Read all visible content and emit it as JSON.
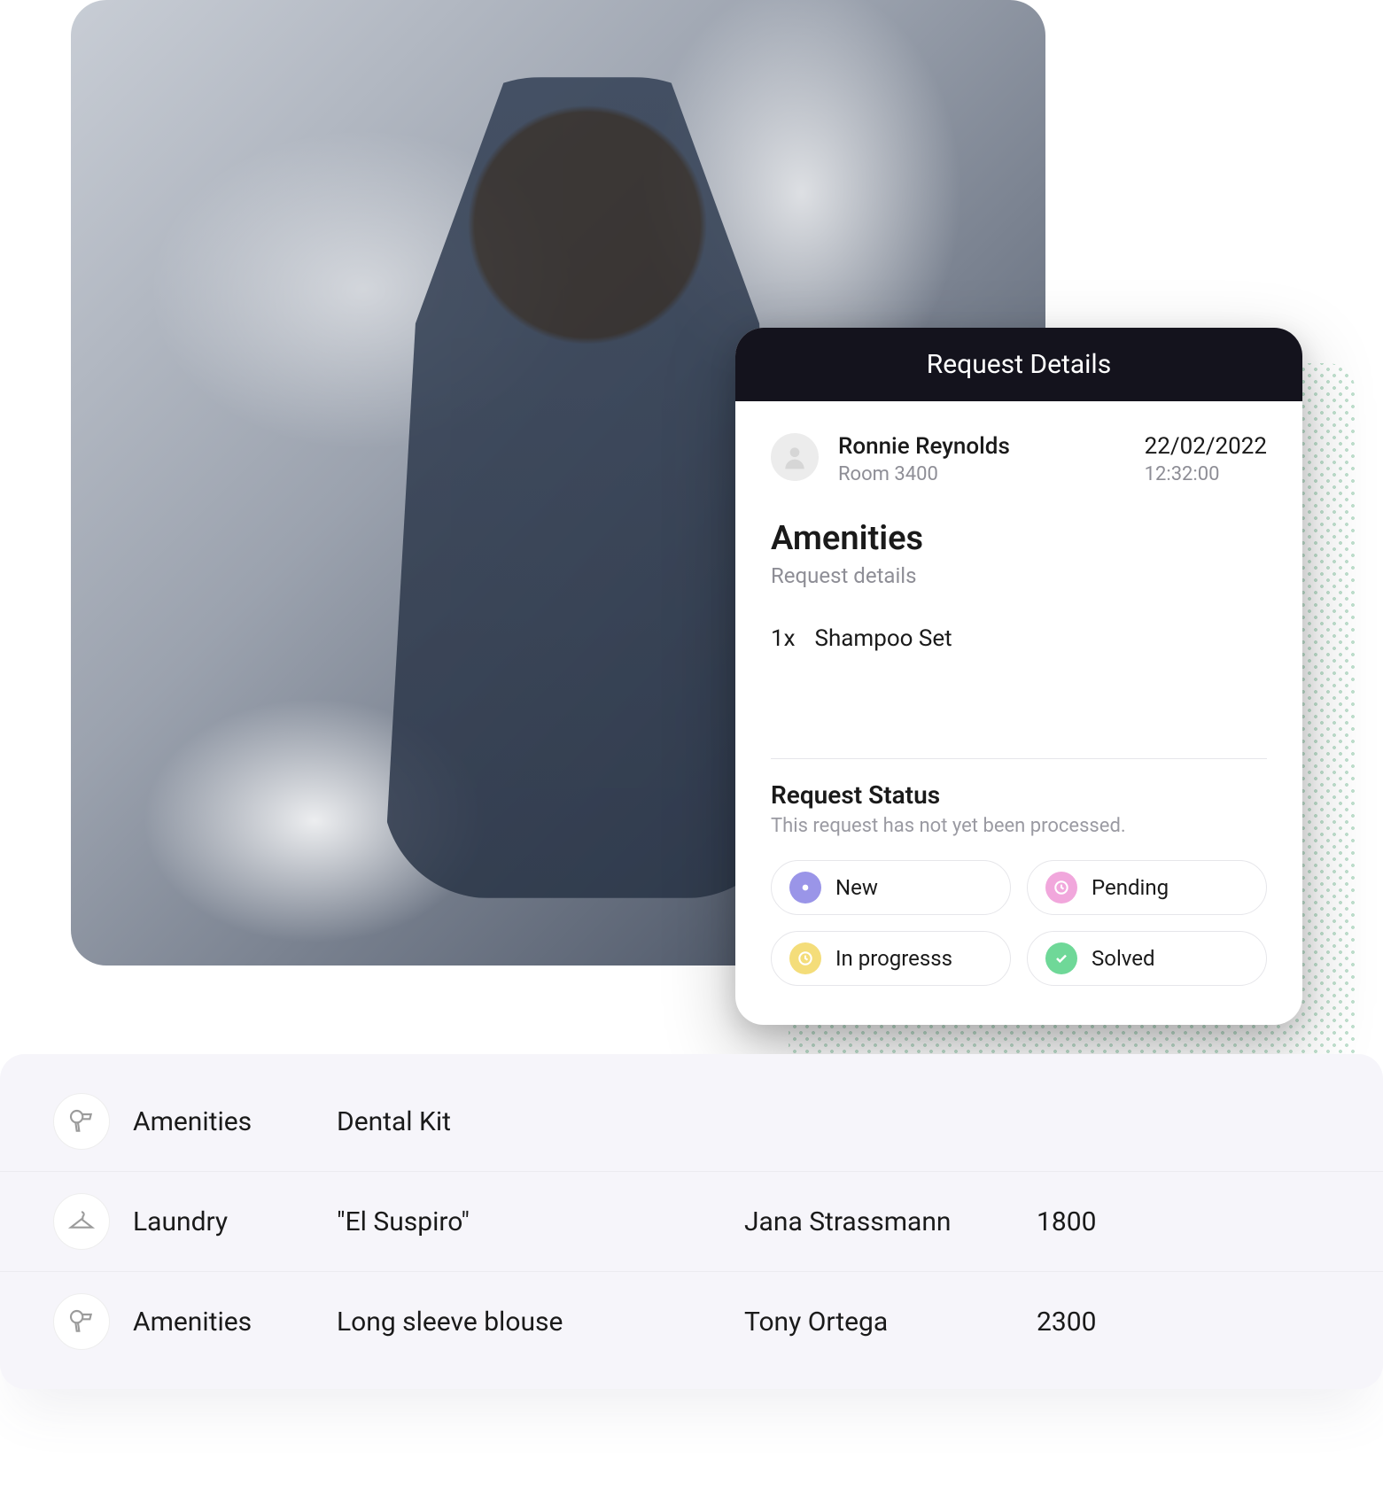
{
  "requestCard": {
    "headerTitle": "Request Details",
    "guest": {
      "name": "Ronnie Reynolds",
      "room": "Room 3400",
      "date": "22/02/2022",
      "time": "12:32:00"
    },
    "section": {
      "title": "Amenities",
      "subtitle": "Request details"
    },
    "lineItem": {
      "qty": "1x",
      "name": "Shampoo Set"
    },
    "status": {
      "title": "Request Status",
      "subtitle": "This request has not yet been processed.",
      "options": {
        "new": {
          "label": "New",
          "color": "#9a95e8"
        },
        "pending": {
          "label": "Pending",
          "color": "#f1a7dc"
        },
        "inprogress": {
          "label": "In progresss",
          "color": "#f4dd7a"
        },
        "solved": {
          "label": "Solved",
          "color": "#6fd898"
        }
      }
    }
  },
  "list": {
    "rows": [
      {
        "icon": "hairdryer",
        "category": "Amenities",
        "desc": "Dental Kit",
        "guest": "",
        "room": ""
      },
      {
        "icon": "hanger",
        "category": "Laundry",
        "desc": "\"El Suspiro\"",
        "guest": "Jana Strassmann",
        "room": "1800"
      },
      {
        "icon": "hairdryer",
        "category": "Amenities",
        "desc": "Long sleeve blouse",
        "guest": "Tony Ortega",
        "room": "2300"
      }
    ]
  }
}
